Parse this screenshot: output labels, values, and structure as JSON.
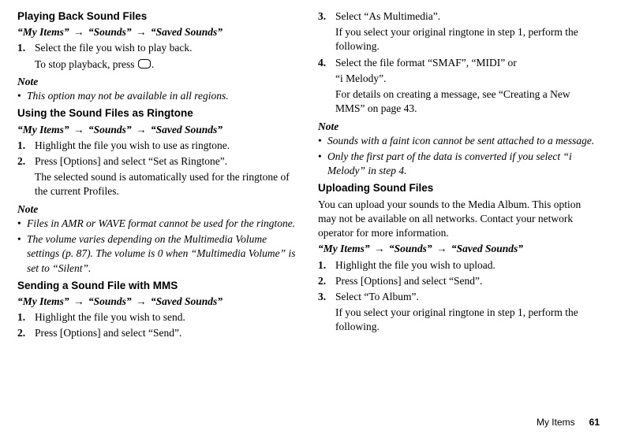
{
  "nav": {
    "my_items": "“My Items”",
    "sounds": "“Sounds”",
    "saved_sounds": "“Saved Sounds”"
  },
  "left": {
    "h_playing": "Playing Back Sound Files",
    "play_step1": "Select the file you wish to play back.",
    "play_stop_pre": "To stop playback, press ",
    "play_stop_post": ".",
    "note1_label": "Note",
    "note1_b1": "This option may not be available in all regions.",
    "h_ringtone": "Using the Sound Files as Ringtone",
    "rt_step1": "Highlight the file you wish to use as ringtone.",
    "rt_step2": "Press [Options] and select “Set as Ringtone”.",
    "rt_step2_body": "The selected sound is automatically used for the ringtone of the current Profiles.",
    "note2_label": "Note",
    "note2_b1": "Files in AMR or WAVE format cannot be used for the ringtone.",
    "note2_b2": "The volume varies depending on the Multimedia Volume settings (p. 87). The volume is 0 when “Multimedia Volume” is set to “Silent”.",
    "h_mms": "Sending a Sound File with MMS",
    "mms_step1": "Highlight the file you wish to send.",
    "mms_step2": "Press [Options] and select “Send”."
  },
  "right": {
    "mms_step3": "Select “As Multimedia”.",
    "mms_step3_body": "If you select your original ringtone in step 1, perform the following.",
    "mms_step4a": "Select the file format “SMAF”, “MIDI” or",
    "mms_step4b": "“i Melody”.",
    "mms_step4_body": "For details on creating a message, see “Creating a New MMS” on page 43.",
    "note3_label": "Note",
    "note3_b1": "Sounds with a faint icon cannot be sent attached to a message.",
    "note3_b2": "Only the first part of the data is converted if you select “i Melody” in step 4.",
    "h_upload": "Uploading Sound Files",
    "upload_intro": "You can upload your sounds to the Media Album. This option may not be available on all networks. Contact your network operator for more information.",
    "up_step1": "Highlight the file you wish to upload.",
    "up_step2": "Press [Options] and select “Send”.",
    "up_step3": "Select “To Album”.",
    "up_step3_body": "If you select your original ringtone in step 1, perform the following."
  },
  "footer": {
    "section": "My Items",
    "page": "61"
  }
}
